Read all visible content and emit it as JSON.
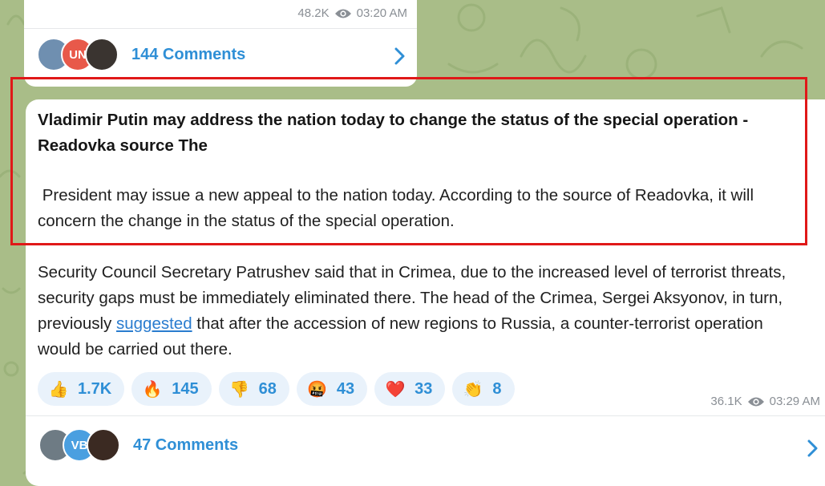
{
  "previous_post": {
    "views": "48.2K",
    "time": "03:20 AM",
    "comments_label": "144 Comments",
    "avatars": [
      {
        "initials": "",
        "color": "#6f8fb0"
      },
      {
        "initials": "UN",
        "color": "#e8594a"
      },
      {
        "initials": "",
        "color": "#3a3430"
      }
    ]
  },
  "post": {
    "headline": "Vladimir Putin may address the nation today to change the status of the special operation - Readovka source The",
    "paragraph1": " President may issue a new appeal to the nation today. According to the source of Readovka, it will concern the change in the status of the special operation.",
    "paragraph2_before": "Security Council Secretary Patrushev said that in Crimea, due to the increased level of terrorist threats, security gaps must be immediately eliminated there. The head of the Crimea, Sergei Aksyonov, in turn, previously ",
    "paragraph2_link": "suggested",
    "paragraph2_after": " that after the accession of new regions to Russia, a counter-terrorist operation would be carried out there.",
    "reactions": [
      {
        "emoji": "👍",
        "icon": "thumbs-up-icon",
        "count": "1.7K"
      },
      {
        "emoji": "🔥",
        "icon": "fire-icon",
        "count": "145"
      },
      {
        "emoji": "👎",
        "icon": "thumbs-down-icon",
        "count": "68"
      },
      {
        "emoji": "🤬",
        "icon": "angry-face-icon",
        "count": "43"
      },
      {
        "emoji": "❤️",
        "icon": "heart-icon",
        "count": "33"
      },
      {
        "emoji": "👏",
        "icon": "clapping-hands-icon",
        "count": "8"
      }
    ],
    "views": "36.1K",
    "time": "03:29 AM",
    "comments_label": "47 Comments",
    "avatars": [
      {
        "initials": "",
        "color": "#6e7b84"
      },
      {
        "initials": "VB",
        "color": "#4a9fe0"
      },
      {
        "initials": "",
        "color": "#3b2a22"
      }
    ]
  },
  "colors": {
    "background": "#a9bd88",
    "accent": "#2f8fd6",
    "highlight_border": "#e01818"
  }
}
